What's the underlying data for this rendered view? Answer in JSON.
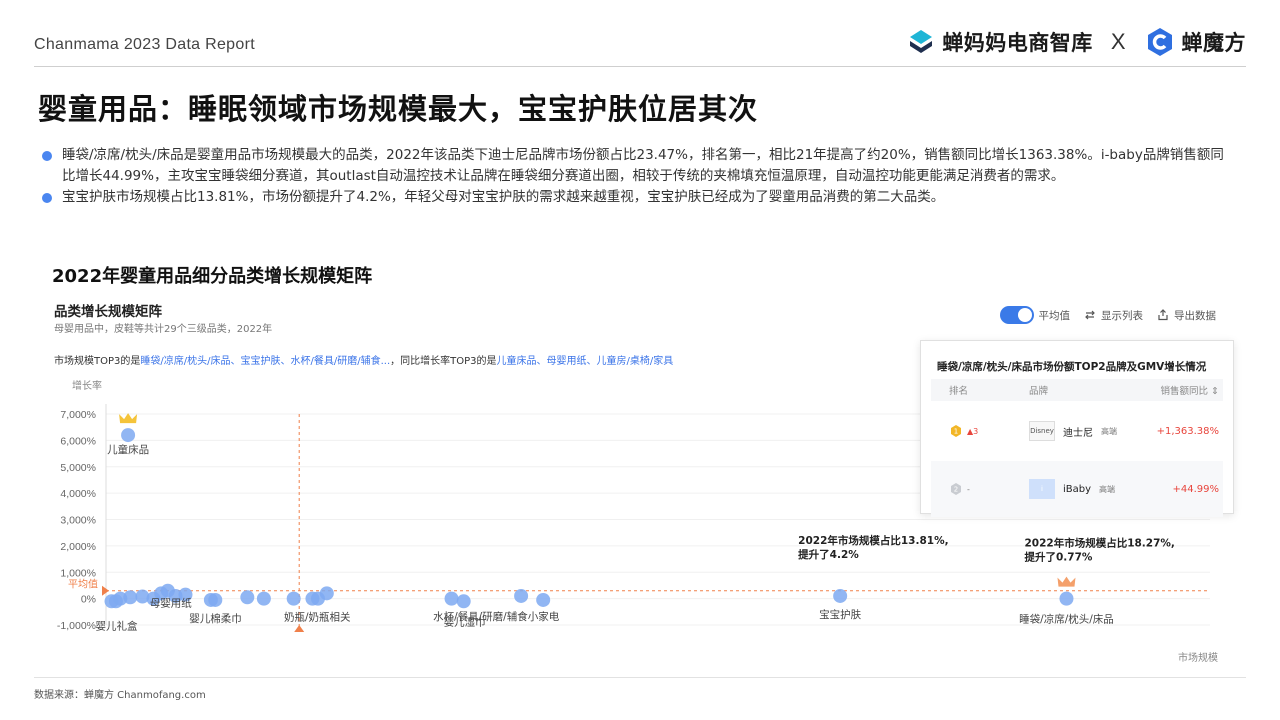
{
  "header": {
    "report_title": "Chanmama 2023 Data Report",
    "brand_left": "蝉妈妈电商智库",
    "brand_x": "X",
    "brand_right": "蝉魔方",
    "accent_color": "#3a7ae8",
    "brand_left_color": "#1fb5d6"
  },
  "main_title": "婴童用品：睡眠领域市场规模最大，宝宝护肤位居其次",
  "bullets": [
    "睡袋/凉席/枕头/床品是婴童用品市场规模最大的品类，2022年该品类下迪士尼品牌市场份额占比23.47%，排名第一，相比21年提高了约20%，销售额同比增长1363.38%。i-baby品牌销售额同比增长44.99%，主攻宝宝睡袋细分赛道，其outlast自动温控技术让品牌在睡袋细分赛道出圈，相较于传统的夹棉填充恒温原理，自动温控功能更能满足消费者的需求。",
    "宝宝护肤市场规模占比13.81%，市场份额提升了4.2%，年轻父母对宝宝护肤的需求越来越重视，宝宝护肤已经成为了婴童用品消费的第二大品类。"
  ],
  "chart_section_title": "2022年婴童用品细分品类增长规模矩阵",
  "panel": {
    "title": "品类增长规模矩阵",
    "subtitle": "母婴用品中，皮鞋等共计29个三级品类，2022年",
    "desc_prefix": "市场规模TOP3的是",
    "desc_top_size": "睡袋/凉席/枕头/床品、宝宝护肤、水杯/餐具/研磨/辅食...",
    "desc_mid": "，同比增长率TOP3的是",
    "desc_top_growth": "儿童床品、母婴用纸、儿童房/桌椅/家具",
    "controls": {
      "average_label": "平均值",
      "show_list_label": "显示列表",
      "export_label": "导出数据"
    }
  },
  "popup": {
    "title": "睡袋/凉席/枕头/床品市场份额TOP2品牌及GMV增长情况",
    "headers": [
      "排名",
      "品牌",
      "销售额同比"
    ],
    "rows": [
      {
        "rank_change": "▲3",
        "brand": "迪士尼",
        "logo_text": "Disney",
        "tag": "高端",
        "gmv_yoy": "+1,363.38%"
      },
      {
        "rank_change": "-",
        "brand": "iBaby",
        "logo_text": "i",
        "tag": "高端",
        "gmv_yoy": "+44.99%"
      }
    ]
  },
  "chart_data": {
    "type": "scatter",
    "title": "品类增长规模矩阵",
    "ylabel": "增长率",
    "xlabel": "市场规模",
    "yticks": [
      "7,000%",
      "6,000%",
      "5,000%",
      "4,000%",
      "3,000%",
      "2,000%",
      "1,000%",
      "0%",
      "-1,000%"
    ],
    "ylim": [
      -1000,
      7000
    ],
    "xlim": [
      0,
      100
    ],
    "average_label": "平均值",
    "average_y": 300,
    "average_x": 17.5,
    "point_color": "#7ea9f1",
    "average_color": "#f0804a",
    "points": [
      {
        "x": 2.0,
        "y": 6200,
        "label": "儿童床品",
        "crown": true
      },
      {
        "x": 0.5,
        "y": -100,
        "label": "婴儿礼盒"
      },
      {
        "x": 0.9,
        "y": -100
      },
      {
        "x": 1.3,
        "y": 0
      },
      {
        "x": 2.2,
        "y": 50
      },
      {
        "x": 3.3,
        "y": 80
      },
      {
        "x": 4.3,
        "y": 0
      },
      {
        "x": 5.0,
        "y": 200
      },
      {
        "x": 5.6,
        "y": 300,
        "label": "母婴用纸"
      },
      {
        "x": 6.3,
        "y": 100
      },
      {
        "x": 7.2,
        "y": 150
      },
      {
        "x": 9.5,
        "y": -50
      },
      {
        "x": 9.9,
        "y": -50,
        "label": "婴儿棉柔巾"
      },
      {
        "x": 12.8,
        "y": 50
      },
      {
        "x": 14.3,
        "y": 0
      },
      {
        "x": 17.0,
        "y": 0
      },
      {
        "x": 18.7,
        "y": 0
      },
      {
        "x": 19.2,
        "y": 0,
        "label": "奶瓶/奶瓶相关"
      },
      {
        "x": 20.0,
        "y": 200
      },
      {
        "x": 31.3,
        "y": 0
      },
      {
        "x": 32.4,
        "y": -100,
        "label": "婴儿湿巾"
      },
      {
        "x": 37.6,
        "y": 100,
        "label": "水杯/餐具/研磨/辅食小家电"
      },
      {
        "x": 39.6,
        "y": -50
      },
      {
        "x": 66.5,
        "y": 100,
        "label": "宝宝护肤"
      },
      {
        "x": 87.0,
        "y": 0,
        "label": "睡袋/凉席/枕头/床品",
        "crown": true
      }
    ],
    "annotations": [
      {
        "line1": "2022年市场规模占比13.81%,",
        "line2": "提升了4.2%",
        "anchor": "宝宝护肤"
      },
      {
        "line1": "2022年市场规模占比18.27%,",
        "line2": "提升了0.77%",
        "anchor": "睡袋/凉席/枕头/床品"
      }
    ]
  },
  "source": "数据来源：蝉魔方 Chanmofang.com"
}
